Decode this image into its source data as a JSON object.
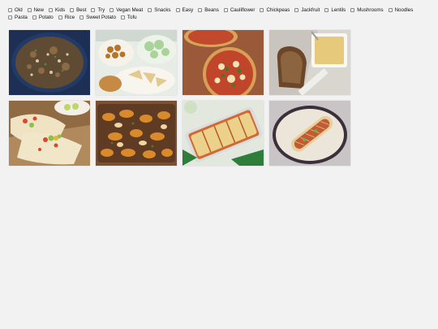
{
  "filters": [
    {
      "label": "Old",
      "checked": false
    },
    {
      "label": "New",
      "checked": false
    },
    {
      "label": "Kids",
      "checked": false
    },
    {
      "label": "Best",
      "checked": false
    },
    {
      "label": "Try",
      "checked": false
    },
    {
      "label": "Vegan Meat",
      "checked": false
    },
    {
      "label": "Snacks",
      "checked": false
    },
    {
      "label": "Easy",
      "checked": false
    },
    {
      "label": "Beans",
      "checked": false
    },
    {
      "label": "Cauliflower",
      "checked": false
    },
    {
      "label": "Chickpeas",
      "checked": false
    },
    {
      "label": "Jackfruit",
      "checked": false
    },
    {
      "label": "Lentils",
      "checked": false
    },
    {
      "label": "Mushrooms",
      "checked": false
    },
    {
      "label": "Noodles",
      "checked": false
    },
    {
      "label": "Pasta",
      "checked": false
    },
    {
      "label": "Potato",
      "checked": false
    },
    {
      "label": "Rice",
      "checked": false
    },
    {
      "label": "Sweet Potato",
      "checked": false
    },
    {
      "label": "Tofu",
      "checked": false
    }
  ],
  "recipes": [
    {
      "image": "grain-bowl-photo"
    },
    {
      "image": "snack-platter-photo"
    },
    {
      "image": "pizza-photo"
    },
    {
      "image": "soup-and-bread-photo"
    },
    {
      "image": "tacos-photo"
    },
    {
      "image": "roasted-vegetables-photo"
    },
    {
      "image": "enchiladas-photo"
    },
    {
      "image": "wrap-photo"
    }
  ]
}
